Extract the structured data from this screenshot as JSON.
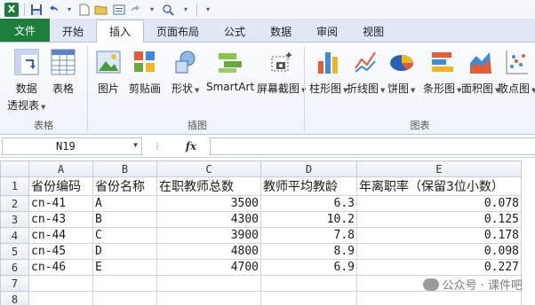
{
  "quick_access": {
    "app_icon": "excel-icon",
    "app_icon_letter": "X",
    "items": [
      "save-icon",
      "undo-icon",
      "new-icon",
      "open-icon",
      "print-preview-icon",
      "redo-icon",
      "quick-print-icon",
      "customize-icon"
    ]
  },
  "tabs": [
    {
      "label": "文件",
      "type": "file"
    },
    {
      "label": "开始"
    },
    {
      "label": "插入",
      "active": true
    },
    {
      "label": "页面布局"
    },
    {
      "label": "公式"
    },
    {
      "label": "数据"
    },
    {
      "label": "审阅"
    },
    {
      "label": "视图"
    }
  ],
  "ribbon": {
    "tables_group": {
      "label": "表格",
      "pivot_line1": "数据",
      "pivot_line2": "透视表",
      "table": "表格"
    },
    "illustrations_group": {
      "label": "插图",
      "picture": "图片",
      "clipart": "剪贴画",
      "shapes": "形状",
      "smartart": "SmartArt",
      "screenshot": "屏幕截图"
    },
    "charts_group": {
      "label": "图表",
      "column": "柱形图",
      "line": "折线图",
      "pie": "饼图",
      "bar": "条形图",
      "area": "面积图",
      "scatter": "散点图"
    }
  },
  "formula_bar": {
    "cell_ref": "N19",
    "fx": "fx",
    "formula": ""
  },
  "sheet": {
    "columns": [
      "A",
      "B",
      "C",
      "D",
      "E"
    ],
    "rows": [
      {
        "num": "1",
        "cells": [
          "省份编码",
          "省份名称",
          "在职教师总数",
          "教师平均教龄",
          "年离职率（保留3位小数）"
        ]
      },
      {
        "num": "2",
        "cells": [
          "cn-41",
          "A",
          "3500",
          "6.3",
          "0.078"
        ]
      },
      {
        "num": "3",
        "cells": [
          "cn-43",
          "B",
          "4300",
          "10.2",
          "0.125"
        ]
      },
      {
        "num": "4",
        "cells": [
          "cn-44",
          "C",
          "3900",
          "7.8",
          "0.178"
        ]
      },
      {
        "num": "5",
        "cells": [
          "cn-45",
          "D",
          "4800",
          "8.9",
          "0.098"
        ]
      },
      {
        "num": "6",
        "cells": [
          "cn-46",
          "E",
          "4700",
          "6.9",
          "0.227"
        ]
      },
      {
        "num": "7",
        "cells": [
          "",
          "",
          "",
          "",
          ""
        ]
      },
      {
        "num": "8",
        "cells": [
          "",
          "",
          "",
          "",
          ""
        ]
      }
    ]
  },
  "watermark": "公众号 · 课件吧"
}
